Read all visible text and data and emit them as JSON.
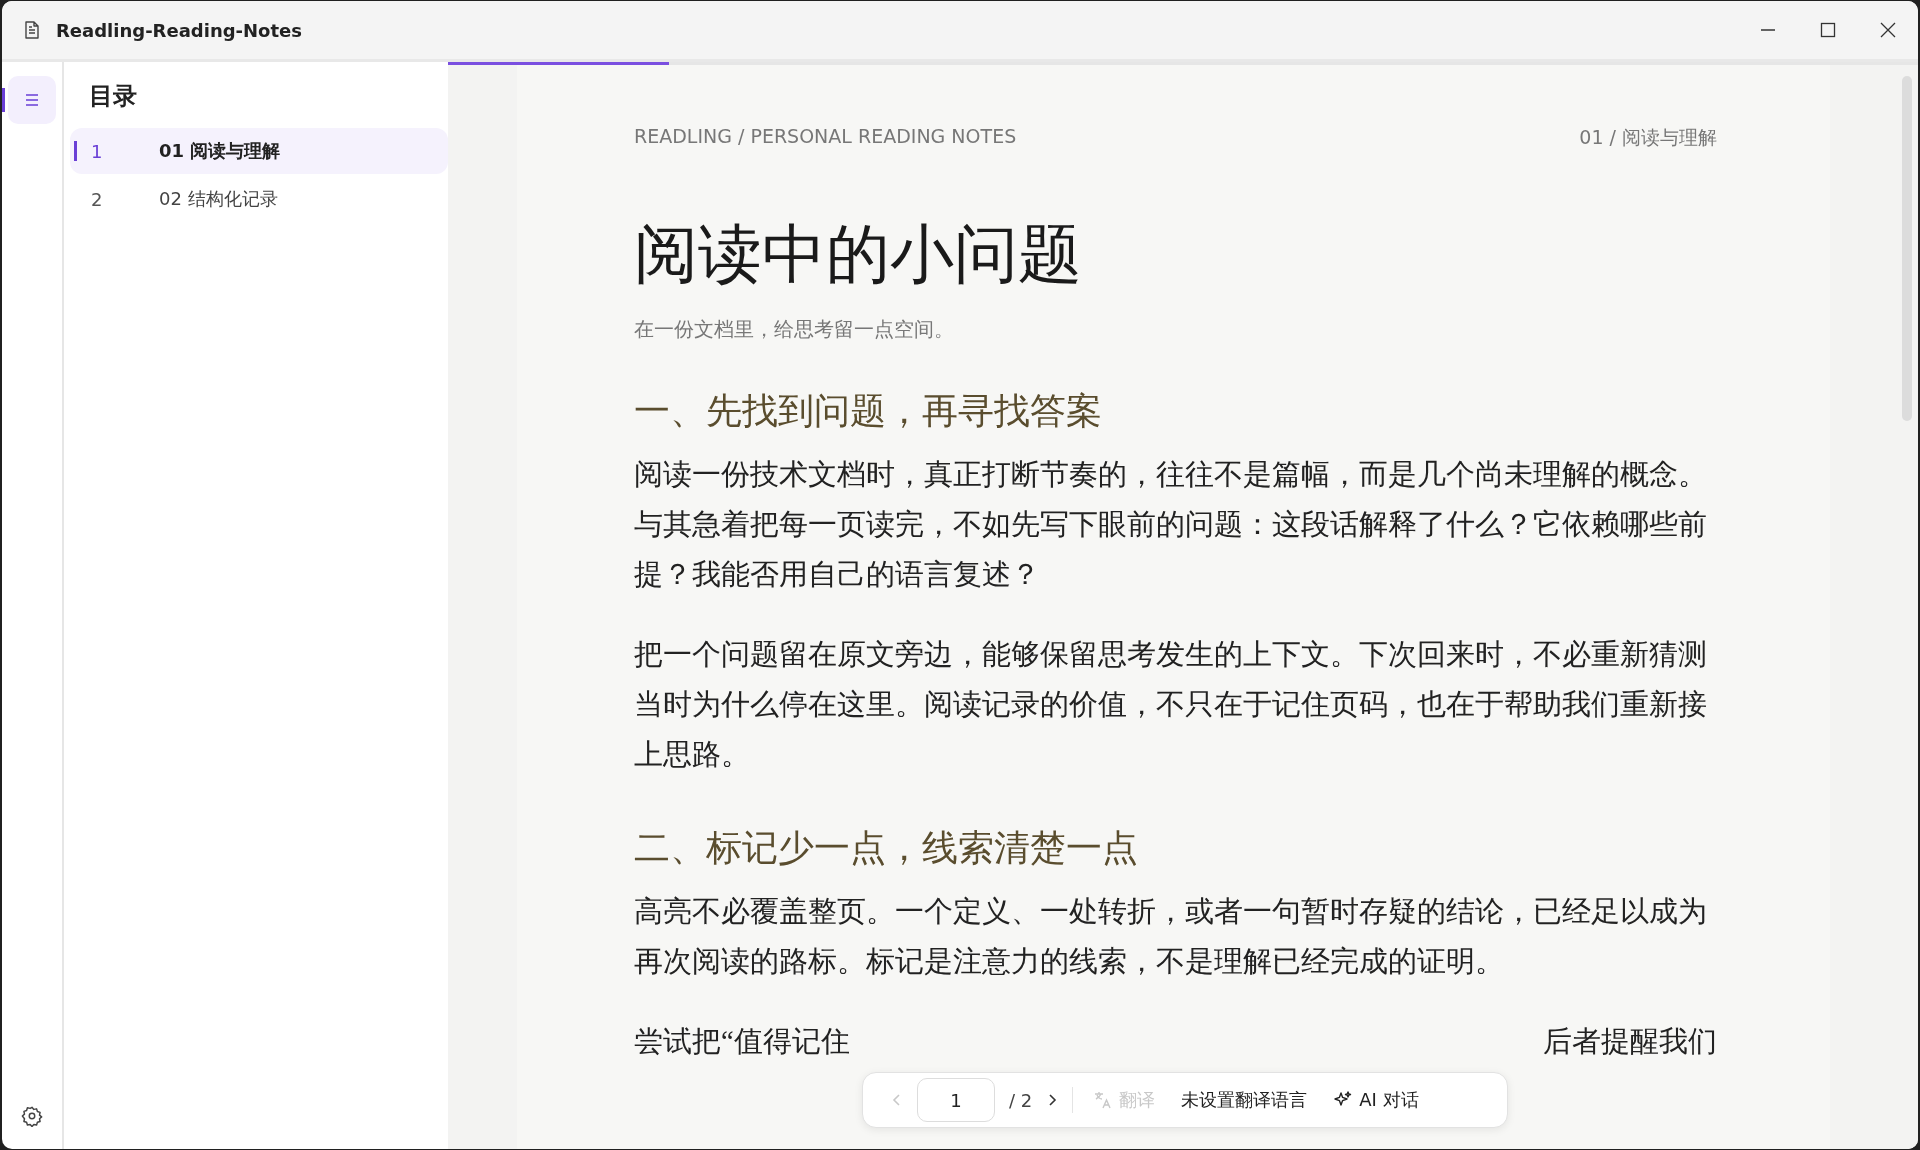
{
  "window": {
    "title": "Readling-Reading-Notes"
  },
  "rail": {
    "toc_selected": true
  },
  "toc": {
    "title": "目录",
    "items": [
      {
        "number": "1",
        "label": "01 阅读与理解",
        "selected": true
      },
      {
        "number": "2",
        "label": "02 结构化记录",
        "selected": false
      }
    ]
  },
  "reader": {
    "progress": {
      "level": 0.15
    },
    "breadcrumb": "READLING / PERSONAL READING NOTES",
    "chapter": "01 / 阅读与理解",
    "title": "阅读中的小问题",
    "subtitle": "在一份文档里，给思考留一点空间。",
    "sections": [
      {
        "heading": "一、先找到问题，再寻找答案",
        "paragraphs": [
          "阅读一份技术文档时，真正打断节奏的，往往不是篇幅，而是几个尚未理解的概念。与其急着把每一页读完，不如先写下眼前的问题：这段话解释了什么？它依赖哪些前提？我能否用自己的语言复述？",
          "把一个问题留在原文旁边，能够保留思考发生的上下文。下次回来时，不必重新猜测当时为什么停在这里。阅读记录的价值，不只在于记住页码，也在于帮助我们重新接上思路。"
        ]
      },
      {
        "heading": "二、标记少一点，线索清楚一点",
        "paragraphs": [
          "高亮不必覆盖整页。一个定义、一处转折，或者一句暂时存疑的结论，已经足以成为再次阅读的路标。标记是注意力的线索，不是理解已经完成的证明。"
        ]
      }
    ],
    "partial_line": {
      "left": "尝试把“值得记住",
      "right": "后者提醒我们"
    }
  },
  "toolbar": {
    "prev_disabled": true,
    "page": "1",
    "total": "/ 2",
    "next_disabled": false,
    "translate": {
      "label": "翻译",
      "disabled": true
    },
    "language": "未设置翻译语言",
    "ai": "AI 对话"
  }
}
